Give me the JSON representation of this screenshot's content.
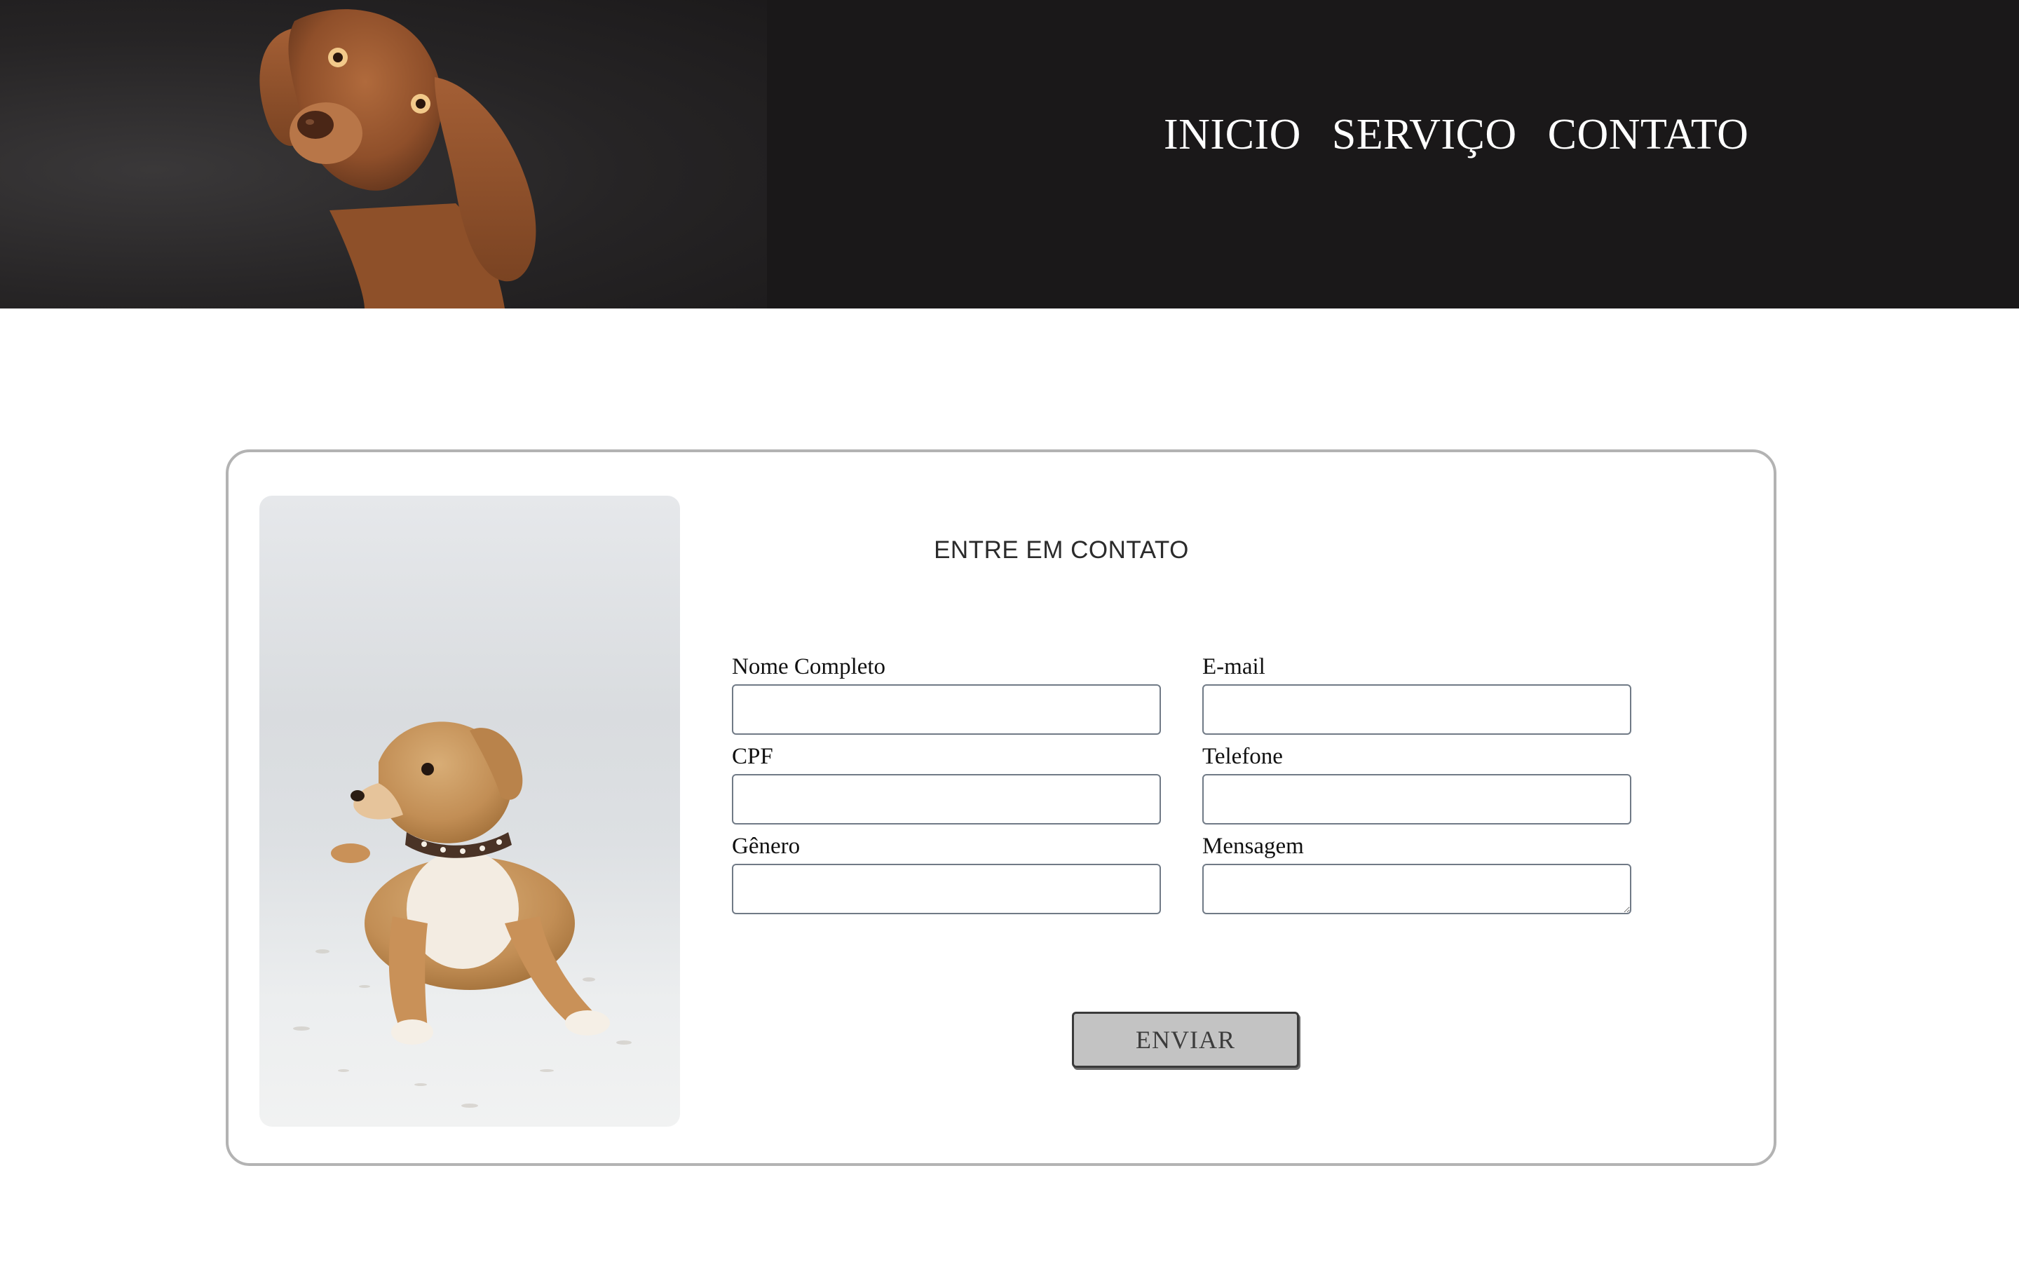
{
  "header": {
    "photo": "dog-portrait-photo",
    "nav": {
      "items": [
        "INICIO",
        "SERVIÇO",
        "CONTATO"
      ]
    }
  },
  "contact": {
    "photo": "small-dog-lying-photo",
    "title": "ENTRE EM CONTATO",
    "fields": {
      "name": {
        "label": "Nome Completo",
        "value": ""
      },
      "email": {
        "label": "E-mail",
        "value": ""
      },
      "cpf": {
        "label": "CPF",
        "value": ""
      },
      "phone": {
        "label": "Telefone",
        "value": ""
      },
      "gender": {
        "label": "Gênero",
        "value": ""
      },
      "message": {
        "label": "Mensagem",
        "value": ""
      }
    },
    "submit_label": "ENVIAR"
  },
  "colors": {
    "header_bg": "#1a1819",
    "nav_text": "#ffffff",
    "card_border": "#b3b3b3",
    "button_bg": "#c3c3c3"
  }
}
